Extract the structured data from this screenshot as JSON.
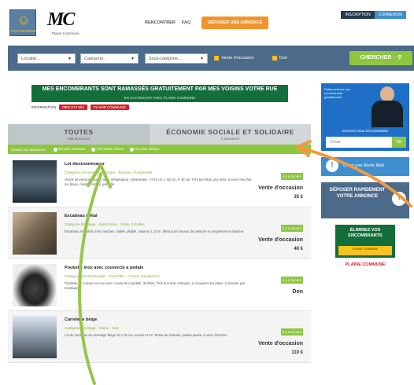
{
  "header": {
    "logo_text": "mes encombrants",
    "brand_logo": "MC",
    "brand_sub": "Plaine Commune",
    "nav": [
      {
        "label": "RENCONTRER"
      },
      {
        "label": "FAQ"
      }
    ],
    "cta_label": "DÉPOSER UNE ANNONCE",
    "account": [
      "INSCRIPTION",
      "CONNEXION"
    ]
  },
  "search": {
    "city_placeholder": "Localité...",
    "category_placeholder": "Catégorie...",
    "subcategory_placeholder": "Sous-catégorie...",
    "opt_used": "Vente d'occasion",
    "opt_free": "Don",
    "button_label": "CHERCHER"
  },
  "banner": {
    "headline": "MES ENCOMBRANTS SONT RAMASSÉS GRATUITEMENT PAR MES VOISINS VOTRE RUE",
    "sub": "EN CHANGEANT AVEC PLAINE COMMUNE",
    "info_label": "INFORMATION",
    "phone": "0800 074 904",
    "partner": "PLAINE COMMUNE"
  },
  "filters": {
    "tabs": [
      {
        "label": "TOUTES",
        "count": "696 annonces"
      },
      {
        "label": "ÉCONOMIE SOCIALE ET SOLIDAIRE",
        "count": "0 annonces"
      }
    ],
    "options_label": "Classer les annonces :",
    "options": [
      "les plus récentes",
      "les moins chères",
      "les plus chères"
    ]
  },
  "listings": [
    {
      "title": "Lot électroménager",
      "category": "Catégorie Ameublement · Stains · Bureaux, Rangement",
      "desc": "Vends lot électroménager avec réfrigérateur. Dimensions : H 93 cm, L 50 cm, P 40 cm. Très bon état, peu servi, à venir chercher sur place, modèle récent, garantie.",
      "tag": "il y a 2 jours",
      "kind": "Vente d'occasion",
      "price": "35 €"
    },
    {
      "title": "Escabeau métal",
      "category": "Catégorie Bricolage · Saint-Denis · Outils, Échelles",
      "desc": "Escabeau en métal, trois marches, stable, pliable. Hauteur 1,10 m. Idéal pour travaux de peinture et rangement en hauteur.",
      "tag": "il y a 3 jours",
      "kind": "Vente d'occasion",
      "price": "40 €"
    },
    {
      "title": "Poubelle inox avec couvercle à pédale",
      "category": "Catégorie Électroménager · Pierrefitte · Cuisine, Rangement",
      "desc": "Poubelle de cuisine en inox avec couvercle à pédale, 30 litres. Très bon état, nettoyée, à récupérer sur place. Contacter par message.",
      "tag": "il y a 5 jours",
      "kind": "Don",
      "price": ""
    },
    {
      "title": "Carrelage beige",
      "category": "Catégorie Bricolage · Stains · Sols",
      "desc": "Lot de carreaux de carrelage beige 30 x 30 cm, environ 4 m². Reste de chantier, jamais posés, à venir chercher.",
      "tag": "il y a 6 jours",
      "kind": "Vente d'occasion",
      "price": "110 €"
    }
  ],
  "sidebar": {
    "promo_text": "Faites enlever vos encombrants gratuitement",
    "newsletter_title": "Inscrivez-vous à la newsletter",
    "email_placeholder": "Email",
    "newsletter_btn": "OK",
    "alert_label": "Créer une Alerte Mail",
    "deposit_title": "DÉPOSER RAPIDEMENT VOTRE ANNONCE",
    "green_ad_title": "ÉLIMINEZ VOS ENCOMBRANTS",
    "green_ad_sub": "PLAINE COMMUNE",
    "partner_logo": "PLAINE COMMUNE"
  },
  "colors": {
    "accent_green": "#8dc63f",
    "header_blue": "#4c6a8a",
    "cta_orange": "#f0952c",
    "arrow_green": "#9ac54a",
    "arrow_orange": "#ef9a3f"
  }
}
